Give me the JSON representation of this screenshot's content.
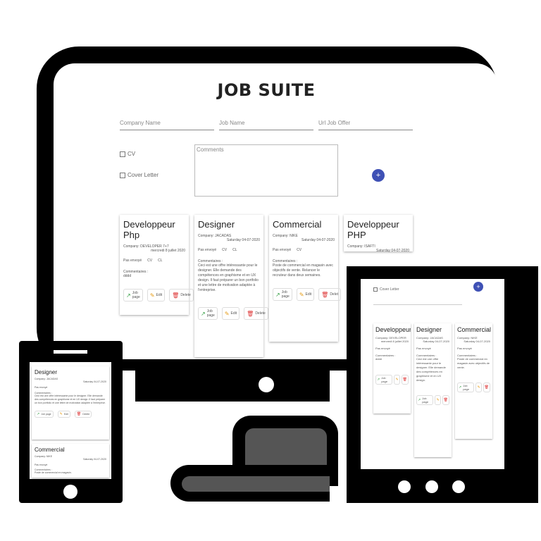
{
  "app": {
    "title": "JOB SUITE"
  },
  "form": {
    "company_placeholder": "Company Name",
    "job_placeholder": "Job Name",
    "url_placeholder": "Url Job Offer",
    "cv_label": "CV",
    "cover_label": "Cover Letter",
    "comments_placeholder": "Comments",
    "add_label": "+"
  },
  "cards": [
    {
      "title": "Developpeur Php",
      "company": "Company: DEVELOPER 7+7",
      "date": "mercredi 8 juillet 2020",
      "status": "Pas envoyé",
      "cv": "CV",
      "cl": "CL",
      "comments_label": "Commentaires :",
      "comments": "dddd",
      "job_page": "Job page",
      "edit": "Edit",
      "delete": "Delete"
    },
    {
      "title": "Designer",
      "company": "Company: JACADAS",
      "date": "Saturday 04-07-2020",
      "status": "Pas envoyé",
      "cv": "CV",
      "cl": "CL",
      "comments_label": "Commentaires :",
      "comments": "Ceci est une offre intéressante pour le designer. Elle demande des compétences en graphisme et en UX design. Il faut préparer un bon portfolio et une lettre de motivation adaptée à l'entreprise.",
      "job_page": "Job page",
      "edit": "Edit",
      "delete": "Delete"
    },
    {
      "title": "Commercial",
      "company": "Company: NIKE",
      "date": "Saturday 04-07-2020",
      "status": "Pas envoyé",
      "cv": "CV",
      "cl": "",
      "comments_label": "Commentaires :",
      "comments": "Poste de commercial en magasin avec objectifs de vente. Relancer le recruteur dans deux semaines.",
      "job_page": "Job page",
      "edit": "Edit",
      "delete": "Delet"
    },
    {
      "title": "Developpeur PHP",
      "company": "Company: ISAFTI",
      "date": "Saturday 04-07-2020"
    }
  ],
  "tablet": {
    "cover_label": "Cover Letter",
    "add_label": "+",
    "cards": [
      {
        "title": "Developpeur Php",
        "company": "Company: DEVELOPER",
        "date": "mercredi 8 juillet 2020",
        "status": "Pas envoyé",
        "comments_label": "Commentaires :",
        "comments": "dddd",
        "job_page": "Job page",
        "edit": "Edit",
        "delete": "Delete"
      },
      {
        "title": "Designer",
        "company": "Company: JACADAS",
        "date": "Saturday 04-07-2020",
        "status": "Pas envoyé",
        "comments_label": "Commentaires :",
        "comments": "Ceci est une offre intéressante pour le designer. Elle demande des compétences en graphisme et en UX design.",
        "job_page": "Job page",
        "edit": "Edit",
        "delete": "Delete"
      },
      {
        "title": "Commercial",
        "company": "Company: NIKE",
        "date": "Saturday 04-07-2020",
        "status": "Pas envoyé",
        "comments_label": "Commentaires :",
        "comments": "Poste de commercial en magasin avec objectifs de vente.",
        "job_page": "Job page",
        "edit": "Edit",
        "delete": "Delete"
      }
    ]
  },
  "phone": {
    "cards": [
      {
        "title": "Designer",
        "company": "Company: JACADAS",
        "date": "Saturday 04-07-2020",
        "status": "Pas envoyé",
        "comments_label": "Commentaires :",
        "comments": "Ceci est une offre intéressante pour le designer. Elle demande des compétences en graphisme et en UX design. Il faut préparer un bon portfolio et une lettre de motivation adaptée à l'entreprise.",
        "job_page": "Job page",
        "edit": "Edit",
        "delete": "Delete"
      },
      {
        "title": "Commercial",
        "company": "Company: NIKE",
        "date": "Saturday 04-07-2020",
        "status": "Pas envoyé",
        "comments_label": "Commentaires :",
        "comments": "Poste de commercial en magasin."
      }
    ]
  },
  "colors": {
    "accent": "#3f51b5",
    "job_page_icon": "#2e9b3e",
    "edit_icon": "#e69a12",
    "delete_icon": "#dd3333"
  }
}
